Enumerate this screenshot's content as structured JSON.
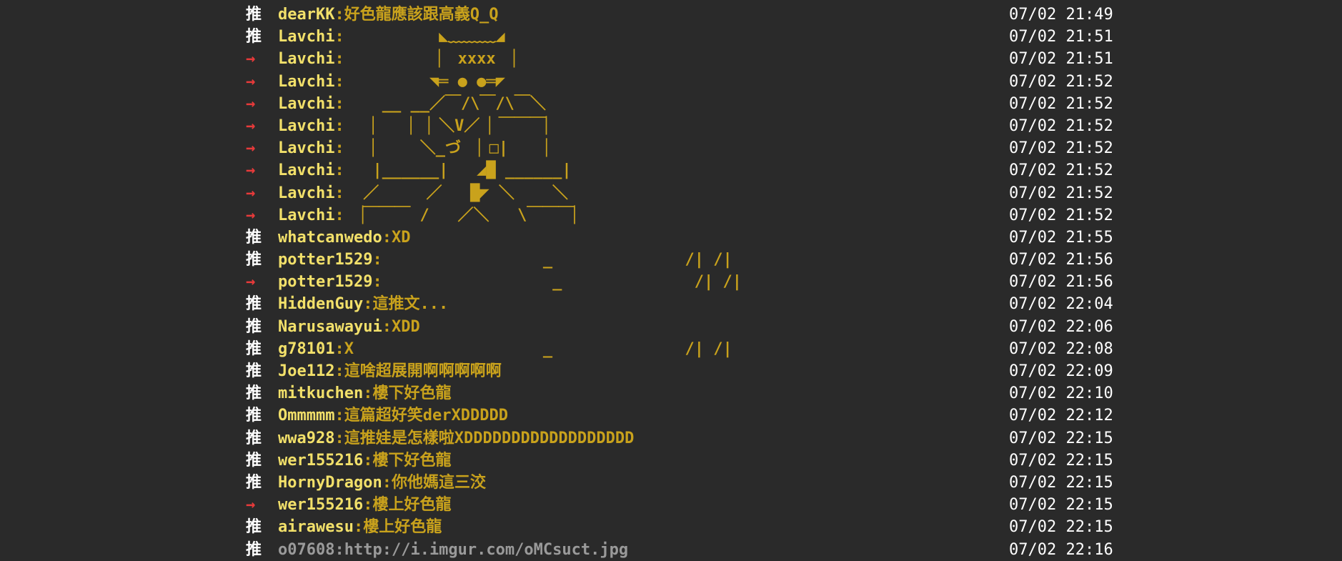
{
  "comments": [
    {
      "tag": "推",
      "user": "dearKK",
      "msg": "好色龍應該跟高義Q_Q",
      "time": "07/02 21:49"
    },
    {
      "tag": "推",
      "user": "Lavchi",
      "msg": "          ◣﹏﹏﹏◢",
      "time": "07/02 21:51"
    },
    {
      "tag": "→",
      "user": "Lavchi",
      "msg": "          ▏ xxxx ▕",
      "time": "07/02 21:51"
    },
    {
      "tag": "→",
      "user": "Lavchi",
      "msg": "         ◥═ ● ●═◤",
      "time": "07/02 21:52"
    },
    {
      "tag": "→",
      "user": "Lavchi",
      "msg": "    __ __／￣/\\￣/\\￣＼",
      "time": "07/02 21:52"
    },
    {
      "tag": "→",
      "user": "Lavchi",
      "msg": "   ▏   ▏▕ ＼V／ ▏￣￣￣▏",
      "time": "07/02 21:52"
    },
    {
      "tag": "→",
      "user": "Lavchi",
      "msg": "   ▏    ＼_づ ▕ □|    ▏",
      "time": "07/02 21:52"
    },
    {
      "tag": "→",
      "user": "Lavchi",
      "msg": "   |______|   ◢█ ______|",
      "time": "07/02 21:52"
    },
    {
      "tag": "→",
      "user": "Lavchi",
      "msg": "  ／     ／   █◤ ＼    ＼",
      "time": "07/02 21:52"
    },
    {
      "tag": "→",
      "user": "Lavchi",
      "msg": " ▕￣￣￣ /   ／＼   \\￣￣￣▏",
      "time": "07/02 21:52"
    },
    {
      "tag": "推",
      "user": "whatcanwedo",
      "msg": "XD",
      "time": "07/02 21:55"
    },
    {
      "tag": "推",
      "user": "potter1529",
      "msg": "                 _              /| /|",
      "time": "07/02 21:56"
    },
    {
      "tag": "→",
      "user": "potter1529",
      "msg": "                  _              /| /|",
      "time": "07/02 21:56"
    },
    {
      "tag": "推",
      "user": "HiddenGuy",
      "msg": "這推文...",
      "time": "07/02 22:04"
    },
    {
      "tag": "推",
      "user": "Narusawayui",
      "msg": "XDD",
      "time": "07/02 22:06"
    },
    {
      "tag": "推",
      "user": "g78101",
      "msg": "X                    _              /| /|",
      "time": "07/02 22:08"
    },
    {
      "tag": "推",
      "user": "Joe112",
      "msg": "這啥超展開啊啊啊啊啊",
      "time": "07/02 22:09"
    },
    {
      "tag": "推",
      "user": "mitkuchen",
      "msg": "樓下好色龍",
      "time": "07/02 22:10"
    },
    {
      "tag": "推",
      "user": "Ommmmm",
      "msg": "這篇超好笑derXDDDDD",
      "time": "07/02 22:12"
    },
    {
      "tag": "推",
      "user": "wwa928",
      "msg": "這推娃是怎樣啦XDDDDDDDDDDDDDDDDDD",
      "time": "07/02 22:15"
    },
    {
      "tag": "推",
      "user": "wer155216",
      "msg": "樓下好色龍",
      "time": "07/02 22:15"
    },
    {
      "tag": "推",
      "user": "HornyDragon",
      "msg": "你他媽這三洨",
      "time": "07/02 22:15"
    },
    {
      "tag": "→",
      "user": "wer155216",
      "msg": "樓上好色龍",
      "time": "07/02 22:15"
    },
    {
      "tag": "推",
      "user": "airawesu",
      "msg": "樓上好色龍",
      "time": "07/02 22:15"
    },
    {
      "tag": "推",
      "user": "o07608",
      "msg": "http://i.imgur.com/oMCsuct.jpg",
      "time": "07/02 22:16"
    }
  ],
  "colors": {
    "background": "#2a2a2a",
    "push_tag": "#ffffff",
    "arrow_tag": "#e83a3a",
    "user": "#f2e06a",
    "message": "#c9a21c",
    "time": "#ffffff"
  }
}
